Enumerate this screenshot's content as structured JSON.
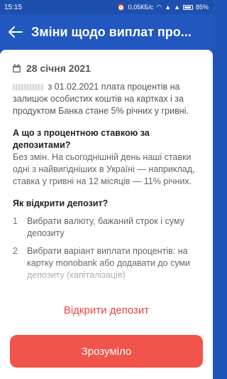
{
  "status_bar": {
    "time": "15:15",
    "network_speed": "0,05КБ/с",
    "battery": "85%"
  },
  "header": {
    "title": "Зміни щодо виплат про..."
  },
  "article": {
    "date": "28 січня 2021",
    "intro": " з 01.02.2021 плата процентів на залишок особистих коштів на картках і за продуктом Банка стане 5% річних у гривні.",
    "q1_title": "А що з процентною ставкою за депозитами?",
    "q1_text": "Без змін. На сьогоднішній день наші ставки одні з найвигідніших в Україні — наприклад, ставка у гривні на 12 місяців — 11% річних.",
    "q2_title": "Як відкрити депозит?",
    "steps": [
      {
        "num": "1",
        "text": "Вибрати валюту, бажаний строк і суму депозиту"
      },
      {
        "num": "2",
        "text": "Вибрати варіант виплати процентів: на картку monobank або додавати до суми депозиту (капіталізація)"
      }
    ]
  },
  "actions": {
    "open_deposit": "Відкрити депозит",
    "ok": "Зрозуміло"
  },
  "colors": {
    "app_bar": "#2257c0",
    "accent_red": "#f0544b"
  }
}
